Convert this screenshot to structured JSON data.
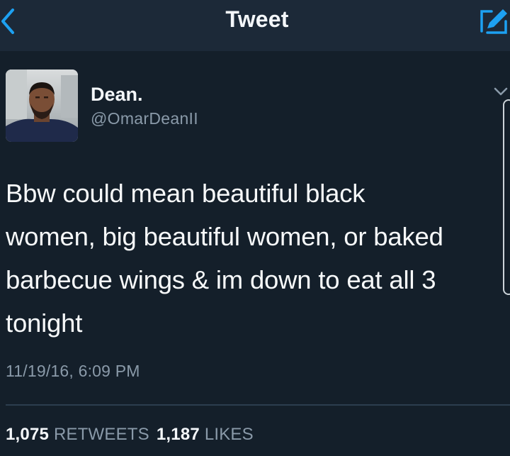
{
  "nav": {
    "title": "Tweet",
    "back_icon": "chevron-left-icon",
    "compose_icon": "compose-icon",
    "accent_color": "#1da1f2"
  },
  "author": {
    "display_name": "Dean.",
    "username": "@OmarDeanII",
    "avatar_icon": "profile-photo"
  },
  "tweet": {
    "lines": [
      "Bbw could mean beautiful black",
      "women, big beautiful women, or baked",
      "barbecue wings & im down to eat all 3",
      "tonight"
    ],
    "timestamp": "11/19/16, 6:09 PM"
  },
  "stats": {
    "retweets_count": "1,075",
    "retweets_label": "RETWEETS",
    "likes_count": "1,187",
    "likes_label": "LIKES"
  },
  "colors": {
    "background": "#141f2a",
    "nav_background": "#1c2938",
    "secondary_text": "#8a9aa9"
  }
}
